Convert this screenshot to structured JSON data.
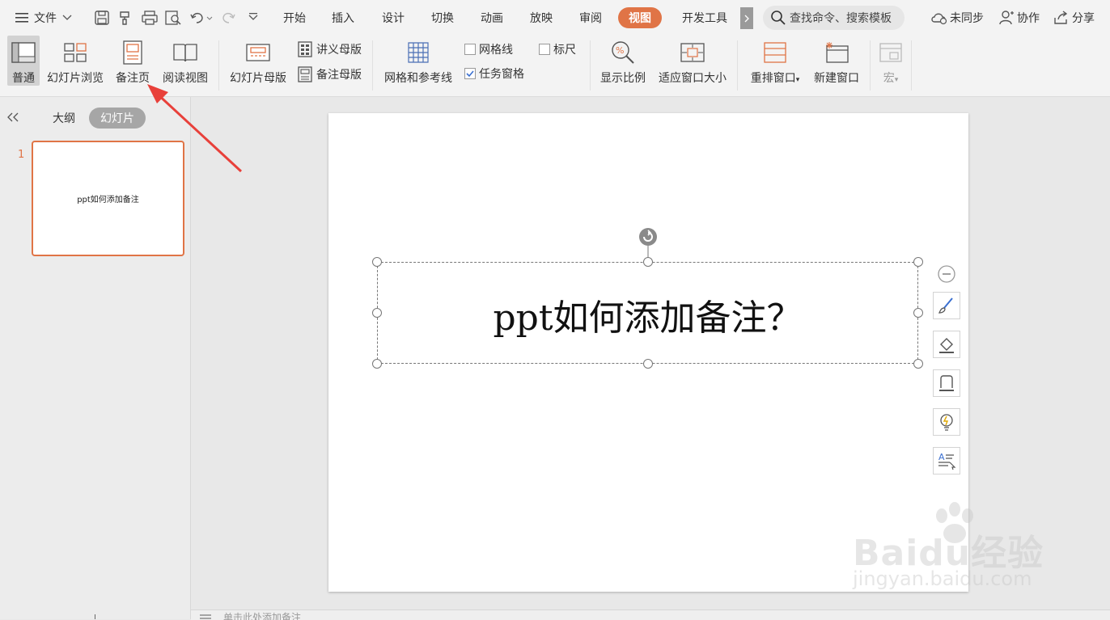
{
  "menubar": {
    "file_label": "文件",
    "tabs": [
      {
        "label": "开始"
      },
      {
        "label": "插入"
      },
      {
        "label": "设计"
      },
      {
        "label": "切换"
      },
      {
        "label": "动画"
      },
      {
        "label": "放映"
      },
      {
        "label": "审阅"
      },
      {
        "label": "视图",
        "active": true
      },
      {
        "label": "开发工具"
      }
    ],
    "search_placeholder": "查找命令、搜索模板",
    "sync_label": "未同步",
    "collab_label": "协作",
    "share_label": "分享"
  },
  "ribbon": {
    "normal": "普通",
    "slide_browse": "幻灯片浏览",
    "notes_page": "备注页",
    "reading_view": "阅读视图",
    "slide_master": "幻灯片母版",
    "handout_master": "讲义母版",
    "notes_master": "备注母版",
    "grid_guides": "网格和参考线",
    "gridlines": {
      "label": "网格线",
      "checked": false
    },
    "ruler": {
      "label": "标尺",
      "checked": false
    },
    "task_pane": {
      "label": "任务窗格",
      "checked": true
    },
    "zoom": "显示比例",
    "fit_window": "适应窗口大小",
    "rearrange": "重排窗口",
    "new_window": "新建窗口",
    "macro": "宏"
  },
  "left_panel": {
    "outline_tab": "大纲",
    "slides_tab": "幻灯片",
    "slide_number": "1",
    "thumb_text": "ppt如何添加备注"
  },
  "slide": {
    "title": "ppt如何添加备注？"
  },
  "notes_hint": "单击此处添加备注",
  "watermark": {
    "brand": "Baidu经验",
    "url": "jingyan.baidu.com"
  },
  "colors": {
    "accent": "#e07446",
    "annotation_arrow": "#e8403a"
  }
}
